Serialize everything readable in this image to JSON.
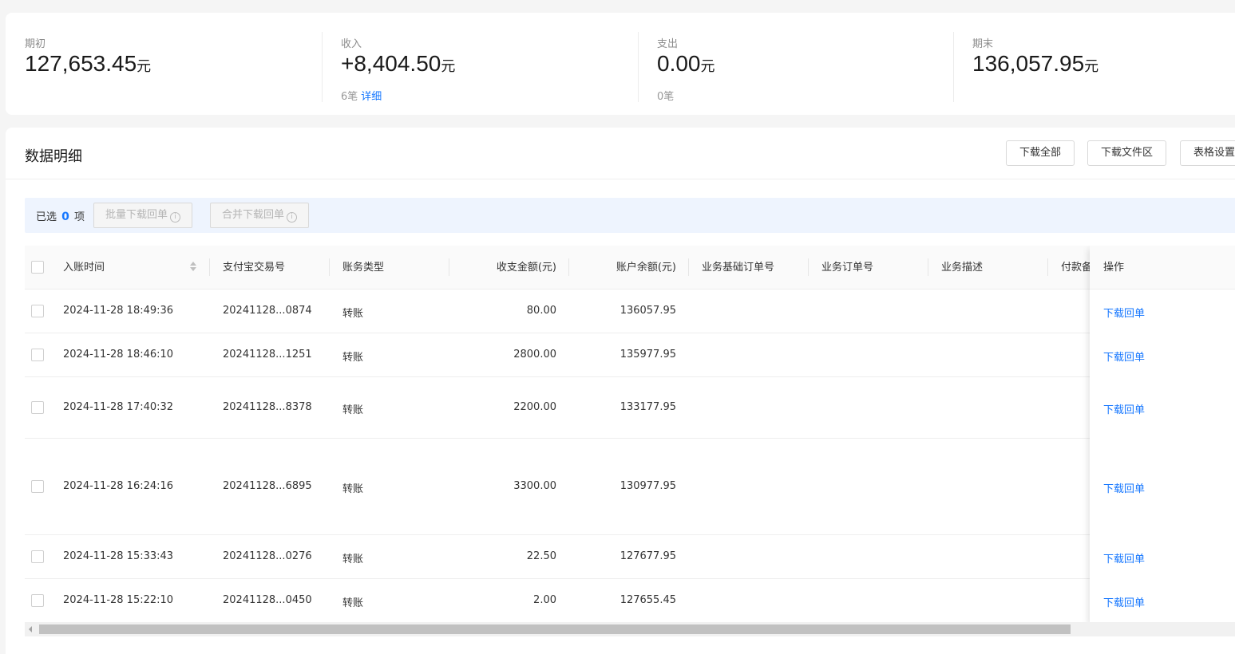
{
  "summary": {
    "opening": {
      "label": "期初",
      "amount": "127,653.45",
      "unit": "元"
    },
    "income": {
      "label": "收入",
      "amount": "+8,404.50",
      "unit": "元",
      "count": "6笔",
      "detail_link": "详细"
    },
    "expense": {
      "label": "支出",
      "amount": "0.00",
      "unit": "元",
      "count": "0笔"
    },
    "closing": {
      "label": "期末",
      "amount": "136,057.95",
      "unit": "元"
    }
  },
  "detail": {
    "title": "数据明细",
    "buttons": {
      "download_all": "下载全部",
      "download_area": "下载文件区",
      "table_settings": "表格设置"
    }
  },
  "selection": {
    "prefix": "已选",
    "count": "0",
    "suffix": "项",
    "batch_download": "批量下载回单",
    "merge_download": "合并下载回单"
  },
  "table": {
    "columns": {
      "time": "入账时间",
      "trade_no": "支付宝交易号",
      "type": "账务类型",
      "amount": "收支金额(元)",
      "balance": "账户余额(元)",
      "base_order": "业务基础订单号",
      "order": "业务订单号",
      "desc": "业务描述",
      "payer_note": "付款备",
      "action": "操作"
    },
    "rows": [
      {
        "time": "2024-11-28 18:49:36",
        "trade_no": "20241128...0874",
        "type": "转账",
        "amount": "80.00",
        "balance": "136057.95",
        "action": "下载回单"
      },
      {
        "time": "2024-11-28 18:46:10",
        "trade_no": "20241128...1251",
        "type": "转账",
        "amount": "2800.00",
        "balance": "135977.95",
        "action": "下载回单"
      },
      {
        "time": "2024-11-28 17:40:32",
        "trade_no": "20241128...8378",
        "type": "转账",
        "amount": "2200.00",
        "balance": "133177.95",
        "action": "下载回单"
      },
      {
        "time": "2024-11-28 16:24:16",
        "trade_no": "20241128...6895",
        "type": "转账",
        "amount": "3300.00",
        "balance": "130977.95",
        "action": "下载回单"
      },
      {
        "time": "2024-11-28 15:33:43",
        "trade_no": "20241128...0276",
        "type": "转账",
        "amount": "22.50",
        "balance": "127677.95",
        "action": "下载回单"
      },
      {
        "time": "2024-11-28 15:22:10",
        "trade_no": "20241128...0450",
        "type": "转账",
        "amount": "2.00",
        "balance": "127655.45",
        "action": "下载回单"
      }
    ]
  }
}
